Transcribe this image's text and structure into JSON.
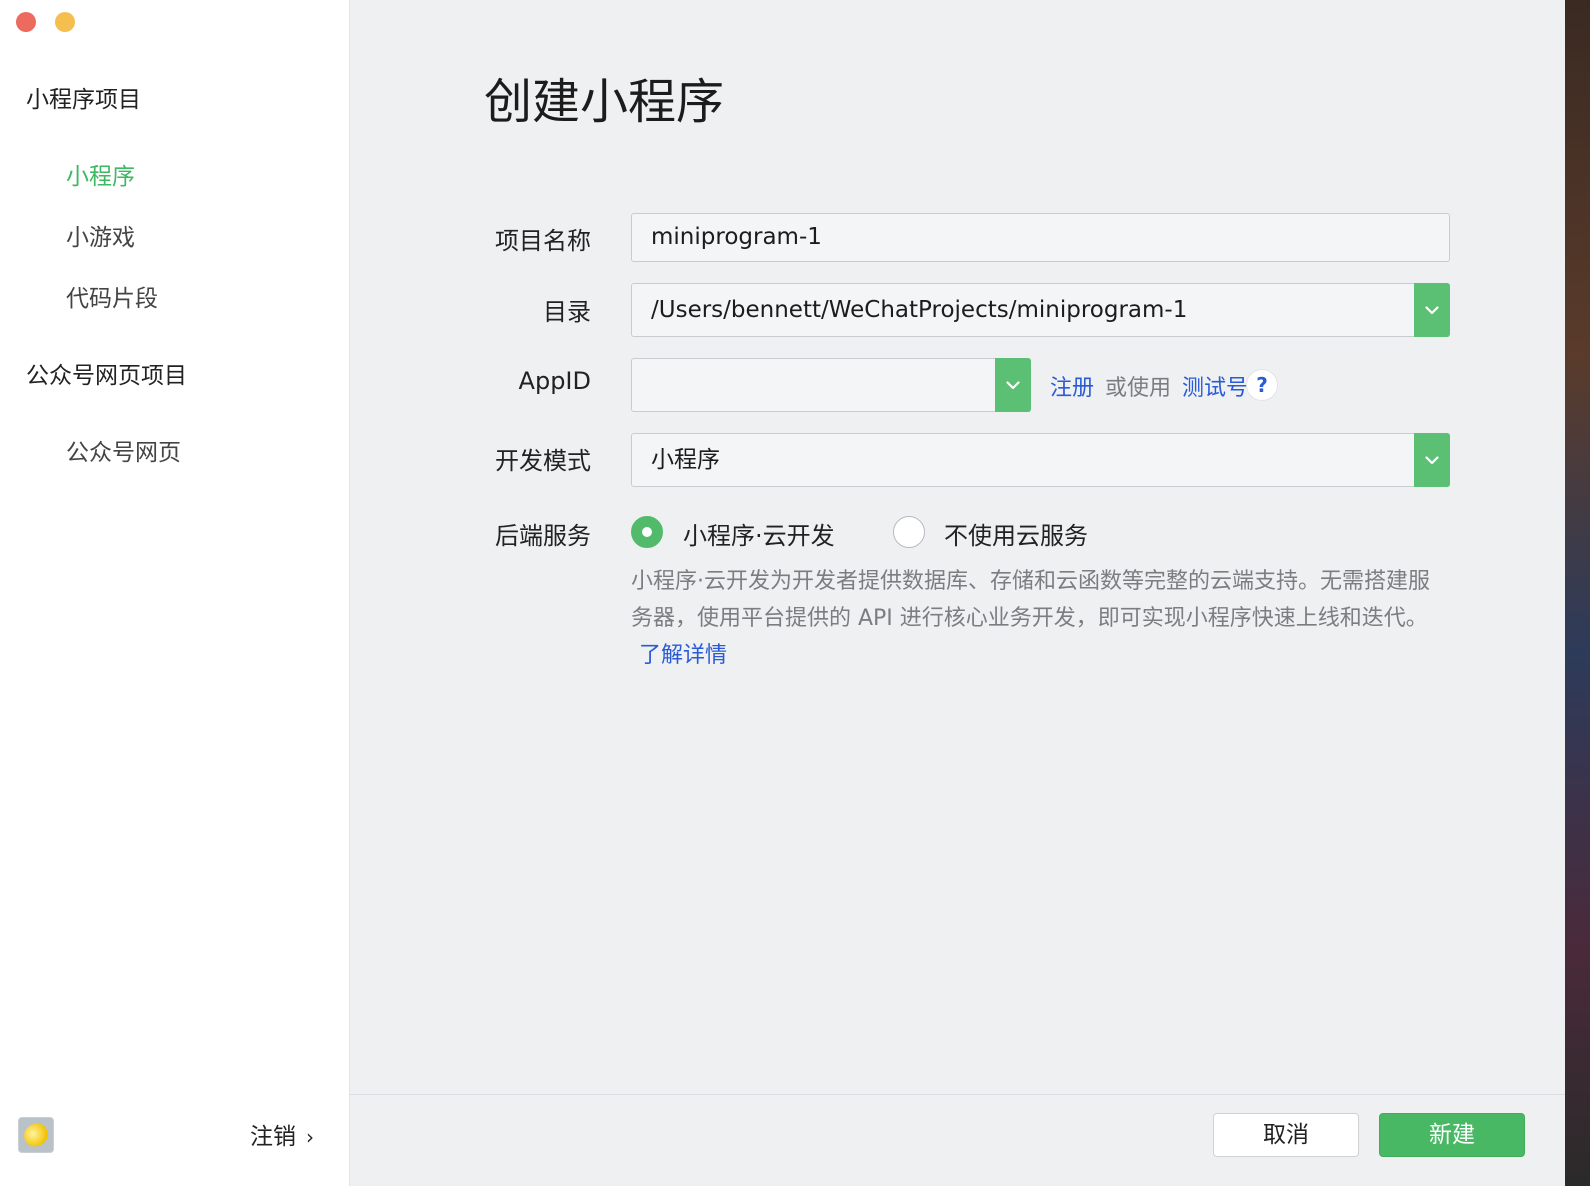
{
  "sidebar": {
    "sections": [
      {
        "title": "小程序项目",
        "items": [
          "小程序",
          "小游戏",
          "代码片段"
        ]
      },
      {
        "title": "公众号网页项目",
        "items": [
          "公众号网页"
        ]
      }
    ],
    "active_item": "小程序",
    "logout_label": "注销",
    "logout_chevron": "›"
  },
  "main": {
    "title": "创建小程序",
    "fields": {
      "project_name": {
        "label": "项目名称",
        "value": "miniprogram-1"
      },
      "directory": {
        "label": "目录",
        "value": "/Users/bennett/WeChatProjects/miniprogram-1"
      },
      "appid": {
        "label": "AppID",
        "value": "",
        "register_link": "注册",
        "or_use": "或使用",
        "test_account_link": "测试号",
        "help": "?"
      },
      "dev_mode": {
        "label": "开发模式",
        "value": "小程序"
      },
      "backend": {
        "label": "后端服务",
        "options": [
          "小程序·云开发",
          "不使用云服务"
        ],
        "selected": "小程序·云开发",
        "description": "小程序·云开发为开发者提供数据库、存储和云函数等完整的云端支持。无需搭建服务器，使用平台提供的 API 进行核心业务开发，即可实现小程序快速上线和迭代。",
        "learn_more": "了解详情"
      }
    }
  },
  "footer": {
    "cancel": "取消",
    "create": "新建"
  },
  "colors": {
    "accent_green": "#3eb862",
    "button_green": "#49b865",
    "link_blue": "#2a5bd7",
    "background": "#eff0f2"
  }
}
